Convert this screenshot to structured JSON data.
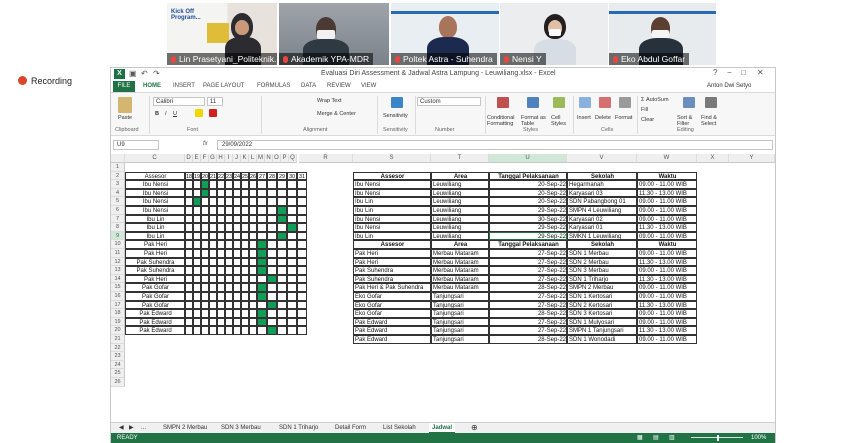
{
  "meeting": {
    "recording_label": "Recording",
    "participants": [
      {
        "name": "Lin Prasetyani_Politeknik..."
      },
      {
        "name": "Akademik YPA-MDR"
      },
      {
        "name": "Poltek Astra - Suhendra"
      },
      {
        "name": "Nensi Y"
      },
      {
        "name": "Eko Abdul Goffar"
      }
    ],
    "slide_text": "Kick Off Program..."
  },
  "excel": {
    "window_title": "Evaluasi Diri Assessment & Jadwal Astra Lampung - Leuwiliang.xlsx - Excel",
    "user": "Anton Dwi Setyo",
    "window_controls": [
      "?",
      "−",
      "□",
      "✕"
    ],
    "tabs": [
      "FILE",
      "HOME",
      "INSERT",
      "PAGE LAYOUT",
      "FORMULAS",
      "DATA",
      "REVIEW",
      "VIEW"
    ],
    "ribbon": {
      "clipboard": "Clipboard",
      "font": "Font",
      "alignment": "Alignment",
      "sensitivity": "Sensitivity",
      "number": "Number",
      "styles": "Styles",
      "cells": "Cells",
      "editing": "Editing",
      "paste": "Paste",
      "font_name": "Calibri",
      "font_size": "11",
      "wrap_text": "Wrap Text",
      "merge_center": "Merge & Center",
      "sensitivity_btn": "Sensitivity",
      "number_format": "Custom",
      "conditional_formatting": "Conditional Formatting",
      "format_as_table": "Format as Table",
      "cell_styles": "Cell Styles",
      "insert": "Insert",
      "delete": "Delete",
      "format": "Format",
      "autosum": "AutoSum",
      "fill": "Fill",
      "clear": "Clear",
      "sort_filter": "Sort & Filter",
      "find_select": "Find & Select"
    },
    "name_box": "U9",
    "formula_value": "29/09/2022",
    "columns": [
      "C",
      "D",
      "E",
      "F",
      "G",
      "H",
      "I",
      "J",
      "K",
      "L",
      "M",
      "N",
      "O",
      "P",
      "Q",
      "R",
      "S",
      "T",
      "U",
      "V",
      "W",
      "X",
      "Y"
    ],
    "rows": [
      "1",
      "2",
      "3",
      "4",
      "5",
      "6",
      "7",
      "8",
      "9",
      "10",
      "11",
      "12",
      "13",
      "14",
      "15",
      "16",
      "17",
      "18",
      "19",
      "20",
      "21",
      "22",
      "23",
      "24",
      "25",
      "26"
    ],
    "left_table": {
      "header": "Assesor",
      "days": [
        "18",
        "19",
        "20",
        "21",
        "22",
        "23",
        "24",
        "25",
        "26",
        "27",
        "28",
        "29",
        "30",
        "31"
      ],
      "assessors": [
        "Ibu Nensi",
        "Ibu Nensi",
        "Ibu Nensi",
        "Ibu Nensi",
        "Ibu Lin",
        "Ibu Lin",
        "Ibu Lin",
        "Pak Heri",
        "Pak Heri",
        "Pak Suhendra",
        "Pak Suhendra",
        "Pak Heri",
        "Pak Gofar",
        "Pak Gofar",
        "Pak Gofar",
        "Pak Edward",
        "Pak Edward",
        "Pak Edward"
      ],
      "marks": [
        [
          2
        ],
        [
          2
        ],
        [
          1
        ],
        [
          11
        ],
        [
          11
        ],
        [
          12
        ],
        [
          11
        ],
        [
          9
        ],
        [
          9
        ],
        [
          9
        ],
        [
          9
        ],
        [
          10
        ],
        [
          9
        ],
        [
          9
        ],
        [
          10
        ],
        [
          9
        ],
        [
          9
        ],
        [
          10
        ]
      ]
    },
    "table1": {
      "headers": [
        "Assesor",
        "Area",
        "Tanggal Pelaksanaan",
        "Sekolah",
        "Waktu"
      ],
      "rows": [
        [
          "Ibu Nensi",
          "Leuwiliang",
          "20-Sep-22",
          "Hegarmanah",
          "09.00 - 11.00 WIB"
        ],
        [
          "Ibu Nensi",
          "Leuwiliang",
          "20-Sep-22",
          "Karyasari 03",
          "11.30 - 13.00 WIB"
        ],
        [
          "Ibu Lin",
          "Leuwiliang",
          "20-Sep-22",
          "SDN Pabangbong 01",
          "09.00 - 11.00 WIB"
        ],
        [
          "Ibu Lin",
          "Leuwiliang",
          "29-Sep-22",
          "SMPN 4 Leuwiliang",
          "09.00 - 11.00 WIB"
        ],
        [
          "Ibu Nensi",
          "Leuwiliang",
          "30-Sep-22",
          "Karyasari 02",
          "09.00 - 11.00 WIB"
        ],
        [
          "Ibu Nensi",
          "Leuwiliang",
          "29-Sep-22",
          "Karyasari 01",
          "11.30 - 13.00 WIB"
        ],
        [
          "Ibu Lin",
          "Leuwiliang",
          "29-Sep-22",
          "SMKN 1 Leuwiliang",
          "09.00 - 11.00 WIB"
        ]
      ]
    },
    "table2": {
      "headers": [
        "Assesor",
        "Area",
        "Tanggal Pelaksanaan",
        "Sekolah",
        "Waktu"
      ],
      "rows": [
        [
          "Pak Heri",
          "Merbau Mataram",
          "27-Sep-22",
          "SDN 1 Merbau",
          "09.00 - 11.00 WIB"
        ],
        [
          "Pak Heri",
          "Merbau Mataram",
          "27-Sep-22",
          "SDN 2 Merbau",
          "11.30 - 13.00 WIB"
        ],
        [
          "Pak Suhendra",
          "Merbau Mataram",
          "27-Sep-22",
          "SDN 3 Merbau",
          "09.00 - 11.00 WIB"
        ],
        [
          "Pak Suhendra",
          "Merbau Mataram",
          "27-Sep-22",
          "SDN 1 Triharjo",
          "11.30 - 13.00 WIB"
        ],
        [
          "Pak Heri & Pak Suhendra",
          "Merbau Mataram",
          "28-Sep-22",
          "SMPN 2 Merbau",
          "09.00 - 11.00 WIB"
        ],
        [
          "Eko Gofar",
          "Tanjungsari",
          "27-Sep-22",
          "SDN 1 Kertosari",
          "09.00 - 11.00 WIB"
        ],
        [
          "Eko Gofar",
          "Tanjungsari",
          "27-Sep-22",
          "SDN 2 Kertosari",
          "11.30 - 13.00 WIB"
        ],
        [
          "Eko Gofar",
          "Tanjungsari",
          "28-Sep-22",
          "SDN 3 Kertosari",
          "09.00 - 11.00 WIB"
        ],
        [
          "Pak Edward",
          "Tanjungsari",
          "27-Sep-22",
          "SDN 1 Mulyosari",
          "09.00 - 11.00 WIB"
        ],
        [
          "Pak Edward",
          "Tanjungsari",
          "27-Sep-22",
          "SMPN 1 Tanjungsari",
          "11.30 - 13.00 WIB"
        ],
        [
          "Pak Edward",
          "Tanjungsari",
          "28-Sep-22",
          "SDN 1 Wonodadi",
          "09.00 - 11.00 WIB"
        ]
      ]
    },
    "sheet_tabs": [
      "...",
      "SMPN 2 Merbau",
      "SDN 3 Merbau",
      "SDN 1 Triharjo",
      "Detail Form",
      "List Sekolah",
      "Jadwal"
    ],
    "active_sheet": "Jadwal",
    "status": "READY",
    "zoom": "100%",
    "colors": {
      "accent": "#217346",
      "mark": "#0f9e55"
    }
  }
}
